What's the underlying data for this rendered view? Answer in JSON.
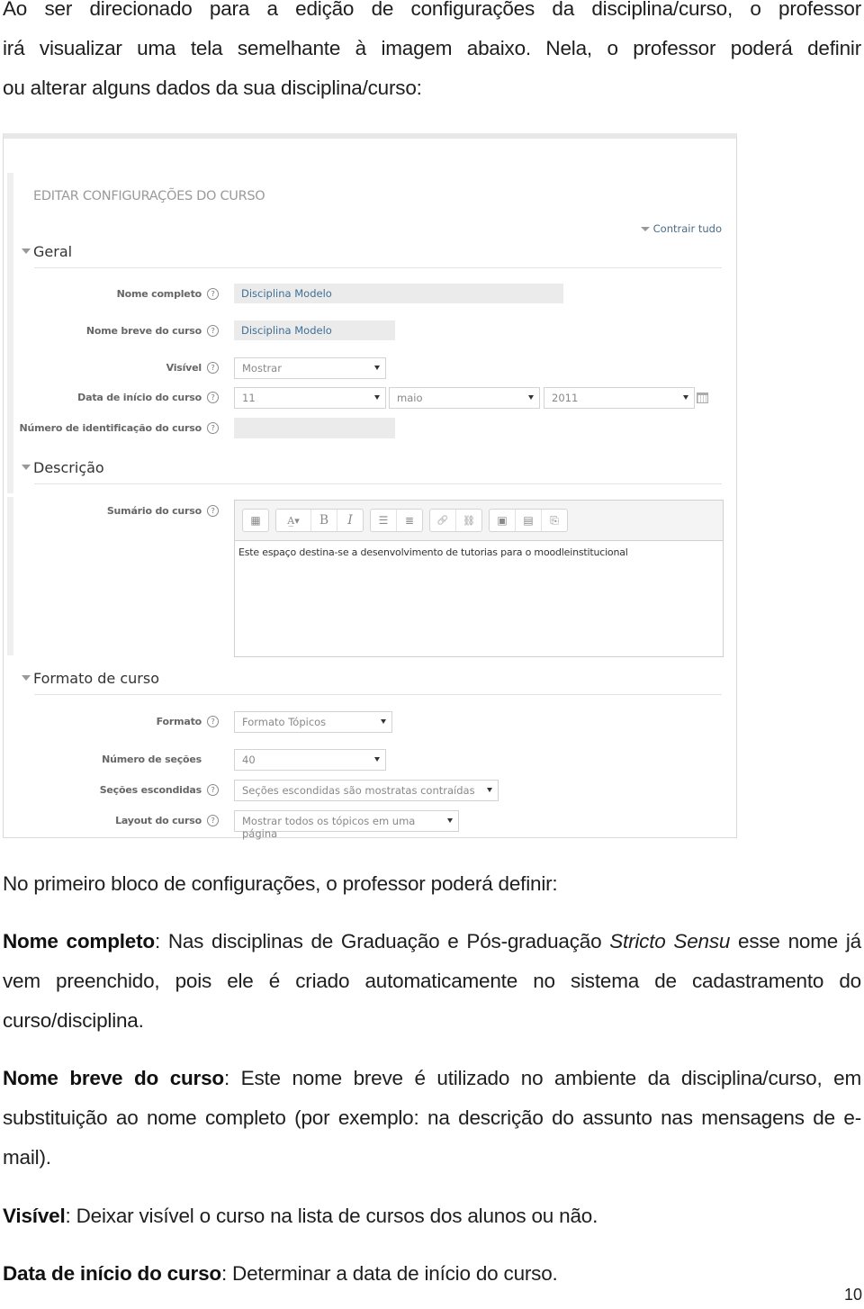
{
  "intro": {
    "line1": "Ao ser direcionado para a edição de configurações da disciplina/curso, o professor",
    "line2": "irá visualizar uma tela semelhante à imagem abaixo. Nela, o professor poderá definir",
    "line3": "ou alterar alguns dados da sua disciplina/curso:"
  },
  "form": {
    "page_heading": "EDITAR CONFIGURAÇÕES DO CURSO",
    "collapse_all": "Contrair tudo",
    "sections": {
      "general": {
        "title": "Geral",
        "full_name": {
          "label": "Nome completo",
          "value": "Disciplina Modelo"
        },
        "short_name": {
          "label": "Nome breve do curso",
          "value": "Disciplina Modelo"
        },
        "visible": {
          "label": "Visível",
          "value": "Mostrar"
        },
        "start_date": {
          "label": "Data de início do curso",
          "day": "11",
          "month": "maio",
          "year": "2011"
        },
        "id_number": {
          "label": "Número de identificação do curso",
          "value": ""
        }
      },
      "description": {
        "title": "Descrição",
        "summary": {
          "label": "Sumário do curso",
          "text": "Este espaço destina-se a desenvolvimento de tutorias para o moodleinstitucional"
        },
        "toolbar": {
          "toggle": "▦",
          "font": "A̲▾",
          "bold": "B",
          "italic": "I",
          "ul": "☰",
          "ol": "≣",
          "link": "🔗",
          "unlink": "⛓",
          "image": "▣",
          "media": "▤",
          "manage": "⎘"
        }
      },
      "format": {
        "title": "Formato de curso",
        "format": {
          "label": "Formato",
          "value": "Formato Tópicos"
        },
        "sections_count": {
          "label": "Número de seções",
          "value": "40"
        },
        "hidden_sections": {
          "label": "Seções escondidas",
          "value": "Seções escondidas são mostratas contraídas"
        },
        "layout": {
          "label": "Layout do curso",
          "value": "Mostrar todos os tópicos em uma página"
        }
      }
    },
    "help_glyph": "?"
  },
  "body": {
    "block_intro": "No primeiro bloco de configurações, o professor poderá definir:",
    "full_name": {
      "term": "Nome completo",
      "text_a": ": Nas disciplinas de Graduação e Pós-graduação ",
      "italic": "Stricto Sensu",
      "text_b": " esse nome já vem preenchido, pois ele é criado automaticamente no sistema de cadastramento do curso/disciplina."
    },
    "short_name": {
      "term": "Nome breve do curso",
      "text": ": Este nome breve é utilizado no ambiente da disciplina/curso, em substituição ao nome completo (por exemplo: na descrição do assunto nas mensagens de e-mail)."
    },
    "visible": {
      "term": "Visível",
      "text": ": Deixar visível o curso na lista de cursos dos alunos ou não."
    },
    "start_date": {
      "term": "Data de início do curso",
      "text": ": Determinar a data de início do curso."
    }
  },
  "page_number": "10"
}
